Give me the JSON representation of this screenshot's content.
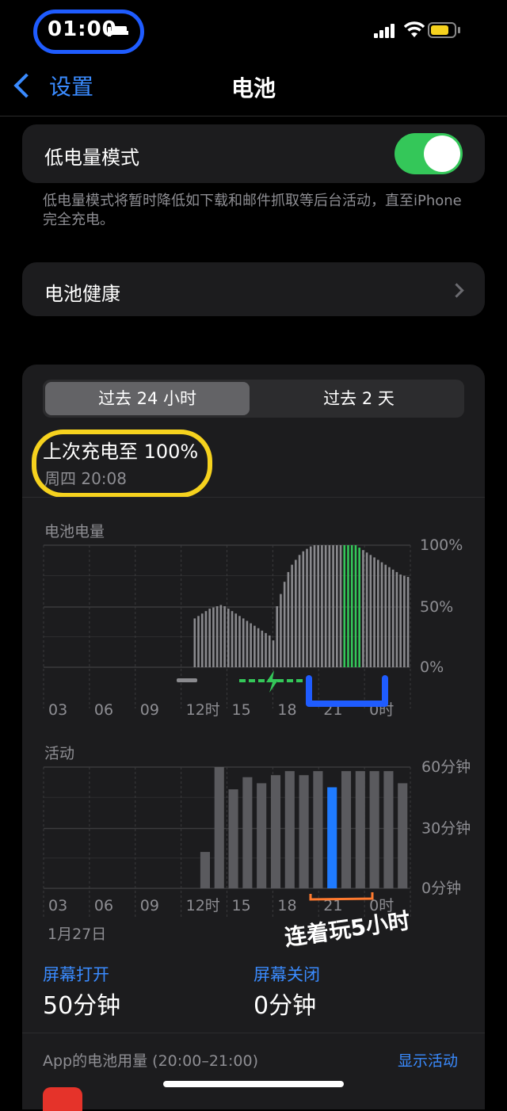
{
  "status": {
    "time": "01:00"
  },
  "nav": {
    "back_label": "设置",
    "title": "电池"
  },
  "low_power": {
    "label": "低电量模式",
    "on": true,
    "footer": "低电量模式将暂时降低如下载和邮件抓取等后台活动，直至iPhone完全充电。"
  },
  "health": {
    "label": "电池健康"
  },
  "segments": {
    "tab1": "过去 24 小时",
    "tab2": "过去 2 天"
  },
  "last_charge": {
    "title": "上次充电至 100%",
    "time": "周四 20:08"
  },
  "battery_chart_title": "电池电量",
  "activity_chart_title": "活动",
  "date_label": "1月27日",
  "handwritten_note": "连着玩5小时",
  "screen_on": {
    "label": "屏幕打开",
    "value": "50分钟"
  },
  "screen_off": {
    "label": "屏幕关闭",
    "value": "0分钟"
  },
  "app_usage": {
    "title": "App的电池用量 (20:00–21:00)",
    "action": "显示活动"
  },
  "colors": {
    "accent": "#3a8bff",
    "toggle_on": "#34c759",
    "battery_fill": "#f6d21e",
    "highlight": "#1f5cff",
    "charging": "#34c759"
  },
  "chart_data": [
    {
      "type": "bar",
      "title": "电池电量",
      "x_ticks": [
        "03",
        "06",
        "09",
        "12时",
        "15",
        "18",
        "21",
        "0时"
      ],
      "y_ticks": [
        "100%",
        "50%",
        "0%"
      ],
      "ylim": [
        0,
        100
      ],
      "values": [
        0,
        0,
        0,
        0,
        0,
        0,
        0,
        0,
        0,
        0,
        0,
        0,
        0,
        0,
        0,
        0,
        0,
        0,
        0,
        0,
        0,
        0,
        0,
        0,
        0,
        0,
        0,
        0,
        0,
        0,
        0,
        0,
        0,
        0,
        0,
        0,
        0,
        0,
        0,
        0,
        40,
        42,
        44,
        46,
        48,
        49,
        50,
        51,
        50,
        48,
        46,
        44,
        42,
        40,
        38,
        36,
        34,
        32,
        30,
        28,
        26,
        22,
        50,
        60,
        70,
        78,
        84,
        88,
        92,
        95,
        97,
        99,
        100,
        100,
        100,
        100,
        100,
        100,
        100,
        100,
        100,
        100,
        100,
        100,
        98,
        96,
        94,
        92,
        90,
        88,
        86,
        84,
        82,
        80,
        78,
        76,
        75,
        74
      ],
      "charging_range": [
        80,
        84
      ],
      "grid": true
    },
    {
      "type": "bar",
      "title": "活动",
      "x_ticks": [
        "03",
        "06",
        "09",
        "12时",
        "15",
        "18",
        "21",
        "0时"
      ],
      "y_ticks": [
        "60分钟",
        "30分钟",
        "0分钟"
      ],
      "ylim": [
        0,
        60
      ],
      "values": [
        0,
        0,
        0,
        0,
        0,
        0,
        0,
        0,
        0,
        0,
        0,
        18,
        60,
        49,
        55,
        52,
        56,
        58,
        56,
        58,
        50,
        58,
        58,
        58,
        58,
        52
      ],
      "highlight_index": 20,
      "grid": true
    }
  ]
}
